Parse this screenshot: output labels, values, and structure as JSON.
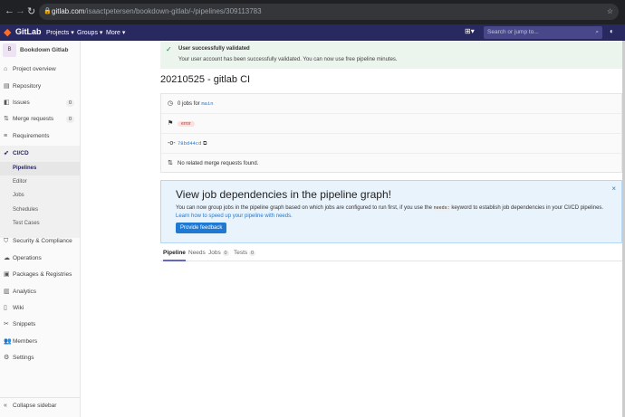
{
  "browser": {
    "url_domain": "gitlab.com",
    "url_path": "/isaactpetersen/bookdown-gitlab/-/pipelines/309113783"
  },
  "topnav": {
    "brand": "GitLab",
    "items": [
      "Projects",
      "Groups",
      "More"
    ],
    "search_placeholder": "Search or jump to..."
  },
  "sidebar": {
    "project_initial": "B",
    "project_name": "Bookdown Gitlab",
    "items": [
      {
        "label": "Project overview"
      },
      {
        "label": "Repository"
      },
      {
        "label": "Issues",
        "count": "0"
      },
      {
        "label": "Merge requests",
        "count": "0"
      },
      {
        "label": "Requirements"
      },
      {
        "label": "CI/CD"
      }
    ],
    "cicd_sub": [
      "Pipelines",
      "Editor",
      "Jobs",
      "Schedules",
      "Test Cases"
    ],
    "items2": [
      "Security & Compliance",
      "Operations",
      "Packages & Registries",
      "Analytics",
      "Wiki",
      "Snippets",
      "Members",
      "Settings"
    ],
    "collapse": "Collapse sidebar"
  },
  "banner": {
    "title": "User successfully validated",
    "body": "Your user account has been successfully validated. You can now use free pipeline minutes."
  },
  "pipeline": {
    "title": "20210525 - gitlab CI",
    "jobs_text": "0 jobs for",
    "branch": "main",
    "status": "error",
    "commit": "78bd44cd",
    "mr_text": "No related merge requests found."
  },
  "info": {
    "title": "View job dependencies in the pipeline graph!",
    "body_pre": "You can now group jobs in the pipeline graph based on which jobs are configured to run first, if you use the",
    "keyword": "needs:",
    "body_post": "keyword to establish job dependencies in your CI/CD pipelines.",
    "link": "Learn how to speed up your pipeline with needs.",
    "button": "Provide feedback"
  },
  "tabs": [
    {
      "label": "Pipeline"
    },
    {
      "label": "Needs"
    },
    {
      "label": "Jobs",
      "count": "0"
    },
    {
      "label": "Tests",
      "count": "0"
    }
  ]
}
